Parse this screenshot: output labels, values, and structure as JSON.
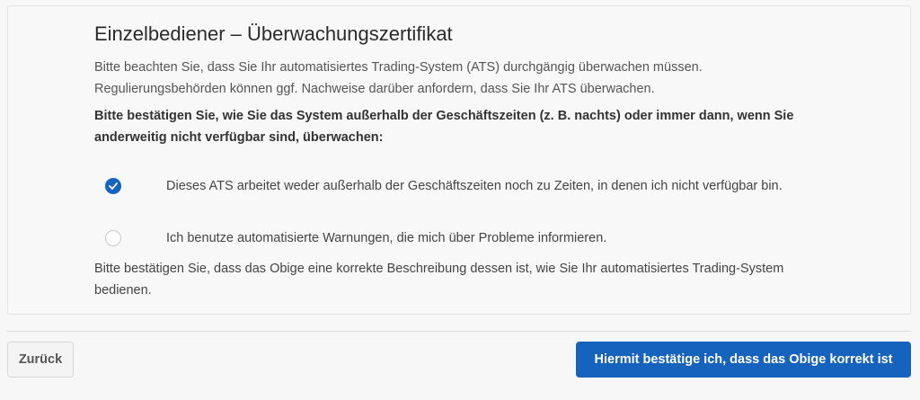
{
  "dialog": {
    "title": "Einzelbediener – Überwachungszertifikat",
    "intro": "Bitte beachten Sie, dass Sie Ihr automatisiertes Trading-System (ATS) durchgängig überwachen müssen. Regulierungsbehörden können ggf. Nachweise darüber anfordern, dass Sie Ihr ATS überwachen.",
    "question": "Bitte bestätigen Sie, wie Sie das System außerhalb der Geschäftszeiten (z. B. nachts) oder immer dann, wenn Sie anderweitig nicht verfügbar sind, überwachen:",
    "options": [
      {
        "label": "Dieses ATS arbeitet weder außerhalb der Geschäftszeiten noch zu Zeiten, in denen ich nicht verfügbar bin.",
        "selected": true
      },
      {
        "label": "Ich benutze automatisierte Warnungen, die mich über Probleme informieren.",
        "selected": false
      }
    ],
    "confirm_text": "Bitte bestätigen Sie, dass das Obige eine korrekte Beschreibung dessen ist, wie Sie Ihr automatisiertes Trading-System bedienen."
  },
  "footer": {
    "back_label": "Zurück",
    "confirm_label": "Hiermit bestätige ich, dass das Obige korrekt ist"
  },
  "colors": {
    "accent": "#1663be",
    "text": "#444444",
    "background": "#f7f7f7"
  },
  "icons": {
    "selected": "radio-checked-icon",
    "unselected": "radio-unchecked-icon"
  }
}
